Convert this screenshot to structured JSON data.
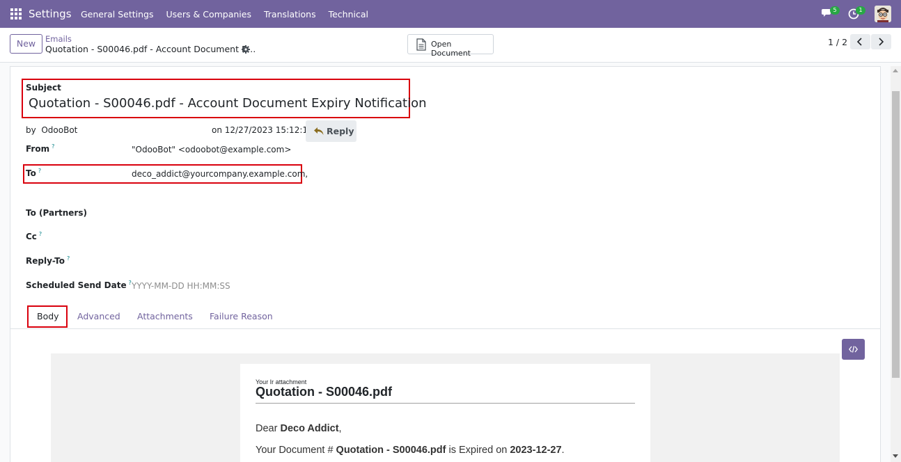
{
  "navbar": {
    "app_name": "Settings",
    "menu": [
      "General Settings",
      "Users & Companies",
      "Translations",
      "Technical"
    ],
    "messages_badge": "5",
    "activities_badge": "1",
    "accent": "#71639e"
  },
  "control": {
    "new_label": "New",
    "breadcrumb_parent": "Emails",
    "breadcrumb_current": "Quotation - S00046.pdf - Account Document E…",
    "open_document_label": "Open Document",
    "pager": "1 / 2"
  },
  "form": {
    "subject_label": "Subject",
    "subject": "Quotation - S00046.pdf - Account Document Expiry Notification",
    "by_prefix": "by",
    "author": "OdooBot",
    "date_text": "on 12/27/2023 15:12:16",
    "reply_label": "Reply",
    "fields": {
      "from_label": "From",
      "from_value": "\"OdooBot\" <odoobot@example.com>",
      "to_label": "To",
      "to_value": "deco_addict@yourcompany.example.com,",
      "to_partners_label": "To (Partners)",
      "cc_label": "Cc",
      "reply_to_label": "Reply-To",
      "scheduled_label": "Scheduled Send Date",
      "scheduled_placeholder": "YYYY-MM-DD HH:MM:SS",
      "help_mark": "?"
    }
  },
  "tabs": [
    "Body",
    "Advanced",
    "Attachments",
    "Failure Reason"
  ],
  "mail_body": {
    "small_header": "Your Ir attachment",
    "title": "Quotation - S00046.pdf",
    "greeting_prefix": "Dear ",
    "partner": "Deco Addict",
    "greeting_suffix": ",",
    "line_prefix": "Your Document # ",
    "document": "Quotation - S00046.pdf",
    "line_middle": " is Expired on ",
    "expiry_date": "2023-12-27",
    "line_suffix": "."
  }
}
